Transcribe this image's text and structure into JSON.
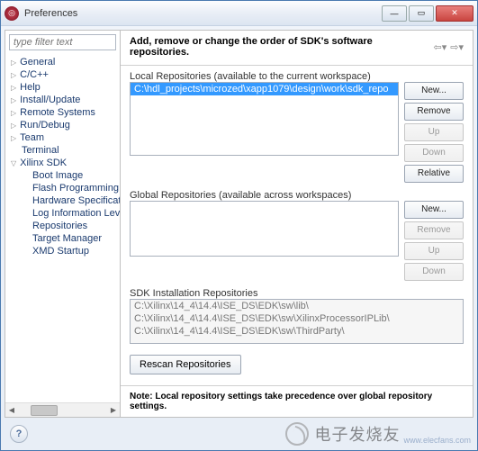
{
  "window": {
    "title": "Preferences"
  },
  "filter": {
    "placeholder": "type filter text"
  },
  "tree": [
    {
      "label": "General",
      "level": 0,
      "exp": true
    },
    {
      "label": "C/C++",
      "level": 0,
      "exp": true
    },
    {
      "label": "Help",
      "level": 0,
      "exp": true
    },
    {
      "label": "Install/Update",
      "level": 0,
      "exp": true
    },
    {
      "label": "Remote Systems",
      "level": 0,
      "exp": true
    },
    {
      "label": "Run/Debug",
      "level": 0,
      "exp": true
    },
    {
      "label": "Team",
      "level": 0,
      "exp": true
    },
    {
      "label": "Terminal",
      "level": 0,
      "exp": false
    },
    {
      "label": "Xilinx SDK",
      "level": 0,
      "exp": true,
      "expanded": true
    },
    {
      "label": "Boot Image",
      "level": 1
    },
    {
      "label": "Flash Programming",
      "level": 1
    },
    {
      "label": "Hardware Specification",
      "level": 1
    },
    {
      "label": "Log Information Level",
      "level": 1
    },
    {
      "label": "Repositories",
      "level": 1
    },
    {
      "label": "Target Manager",
      "level": 1
    },
    {
      "label": "XMD Startup",
      "level": 1
    }
  ],
  "page": {
    "title": "Add, remove or change the order of SDK's software repositories.",
    "local_label": "Local Repositories (available to the current workspace)",
    "local_items": [
      "C:\\hdl_projects\\microzed\\xapp1079\\design\\work\\sdk_repo"
    ],
    "global_label": "Global Repositories (available across workspaces)",
    "sdk_label": "SDK Installation Repositories",
    "sdk_items": [
      "C:\\Xilinx\\14_4\\14.4\\ISE_DS\\EDK\\sw\\lib\\",
      "C:\\Xilinx\\14_4\\14.4\\ISE_DS\\EDK\\sw\\XilinxProcessorIPLib\\",
      "C:\\Xilinx\\14_4\\14.4\\ISE_DS\\EDK\\sw\\ThirdParty\\"
    ],
    "buttons": {
      "new": "New...",
      "remove": "Remove",
      "up": "Up",
      "down": "Down",
      "relative": "Relative"
    },
    "rescan": "Rescan Repositories",
    "note": "Note: Local repository settings take precedence over global repository settings."
  },
  "watermark": {
    "text": "电子发烧友",
    "sub": "www.elecfans.com"
  }
}
